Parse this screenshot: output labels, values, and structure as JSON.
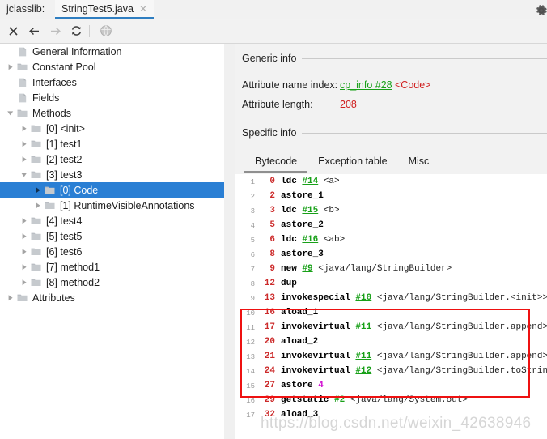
{
  "window": {
    "app_label": "jclasslib:",
    "gear_icon": "gear-icon"
  },
  "tab": {
    "title": "StringTest5.java",
    "close_glyph": "✕"
  },
  "toolbar": {
    "buttons": [
      {
        "name": "close-button",
        "glyph": "✕",
        "enabled": true
      },
      {
        "name": "back-button",
        "glyph": "←",
        "enabled": true
      },
      {
        "name": "forward-button",
        "glyph": "→",
        "enabled": false
      },
      {
        "name": "reload-button",
        "glyph": "⟳",
        "enabled": true
      },
      {
        "name": "browse-button",
        "glyph": "🌐",
        "enabled": false
      }
    ]
  },
  "tree": {
    "items": [
      {
        "label": "General Information",
        "indent": 1,
        "twist": "none",
        "icon": "file",
        "selected": false
      },
      {
        "label": "Constant Pool",
        "indent": 1,
        "twist": "collapsed",
        "icon": "folder",
        "selected": false
      },
      {
        "label": "Interfaces",
        "indent": 1,
        "twist": "none",
        "icon": "file",
        "selected": false
      },
      {
        "label": "Fields",
        "indent": 1,
        "twist": "none",
        "icon": "file",
        "selected": false
      },
      {
        "label": "Methods",
        "indent": 1,
        "twist": "expanded",
        "icon": "folder",
        "selected": false
      },
      {
        "label": "[0] <init>",
        "indent": 2,
        "twist": "collapsed",
        "icon": "folder",
        "selected": false
      },
      {
        "label": "[1] test1",
        "indent": 2,
        "twist": "collapsed",
        "icon": "folder",
        "selected": false
      },
      {
        "label": "[2] test2",
        "indent": 2,
        "twist": "collapsed",
        "icon": "folder",
        "selected": false
      },
      {
        "label": "[3] test3",
        "indent": 2,
        "twist": "expanded",
        "icon": "folder",
        "selected": false
      },
      {
        "label": "[0] Code",
        "indent": 3,
        "twist": "collapsed",
        "icon": "folder",
        "selected": true
      },
      {
        "label": "[1] RuntimeVisibleAnnotations",
        "indent": 3,
        "twist": "collapsed",
        "icon": "folder",
        "selected": false
      },
      {
        "label": "[4] test4",
        "indent": 2,
        "twist": "collapsed",
        "icon": "folder",
        "selected": false
      },
      {
        "label": "[5] test5",
        "indent": 2,
        "twist": "collapsed",
        "icon": "folder",
        "selected": false
      },
      {
        "label": "[6] test6",
        "indent": 2,
        "twist": "collapsed",
        "icon": "folder",
        "selected": false
      },
      {
        "label": "[7] method1",
        "indent": 2,
        "twist": "collapsed",
        "icon": "folder",
        "selected": false
      },
      {
        "label": "[8] method2",
        "indent": 2,
        "twist": "collapsed",
        "icon": "folder",
        "selected": false
      },
      {
        "label": "Attributes",
        "indent": 1,
        "twist": "collapsed",
        "icon": "folder",
        "selected": false
      }
    ]
  },
  "detail": {
    "generic_info_title": "Generic info",
    "specific_info_title": "Specific info",
    "attribute_name_index_label": "Attribute name index:",
    "attribute_name_index_link": "cp_info #28",
    "attribute_name_index_value": "<Code>",
    "attribute_length_label": "Attribute length:",
    "attribute_length_value": "208",
    "tabs": [
      {
        "label": "Bytecode",
        "active": true
      },
      {
        "label": "Exception table",
        "active": false
      },
      {
        "label": "Misc",
        "active": false
      }
    ]
  },
  "bytecode": {
    "lines": [
      {
        "no": "1",
        "offset": "0",
        "mnemonic": "ldc",
        "ref": "#14",
        "desc": "<a>",
        "highlighted": false
      },
      {
        "no": "2",
        "offset": "2",
        "mnemonic": "astore_1",
        "ref": "",
        "desc": "",
        "highlighted": false
      },
      {
        "no": "3",
        "offset": "3",
        "mnemonic": "ldc",
        "ref": "#15",
        "desc": "<b>",
        "highlighted": false
      },
      {
        "no": "4",
        "offset": "5",
        "mnemonic": "astore_2",
        "ref": "",
        "desc": "",
        "highlighted": false
      },
      {
        "no": "5",
        "offset": "6",
        "mnemonic": "ldc",
        "ref": "#16",
        "desc": "<ab>",
        "highlighted": false
      },
      {
        "no": "6",
        "offset": "8",
        "mnemonic": "astore_3",
        "ref": "",
        "desc": "",
        "highlighted": false
      },
      {
        "no": "7",
        "offset": "9",
        "mnemonic": "new",
        "ref": "#9",
        "desc": "<java/lang/StringBuilder>",
        "highlighted": false
      },
      {
        "no": "8",
        "offset": "12",
        "mnemonic": "dup",
        "ref": "",
        "desc": "",
        "highlighted": false
      },
      {
        "no": "9",
        "offset": "13",
        "mnemonic": "invokespecial",
        "ref": "#10",
        "desc": "<java/lang/StringBuilder.<init>>",
        "highlighted": true
      },
      {
        "no": "10",
        "offset": "16",
        "mnemonic": "aload_1",
        "ref": "",
        "desc": "",
        "highlighted": true
      },
      {
        "no": "11",
        "offset": "17",
        "mnemonic": "invokevirtual",
        "ref": "#11",
        "desc": "<java/lang/StringBuilder.append>",
        "highlighted": true
      },
      {
        "no": "12",
        "offset": "20",
        "mnemonic": "aload_2",
        "ref": "",
        "desc": "",
        "highlighted": true
      },
      {
        "no": "13",
        "offset": "21",
        "mnemonic": "invokevirtual",
        "ref": "#11",
        "desc": "<java/lang/StringBuilder.append>",
        "highlighted": true
      },
      {
        "no": "14",
        "offset": "24",
        "mnemonic": "invokevirtual",
        "ref": "#12",
        "desc": "<java/lang/StringBuilder.toString>",
        "highlighted": true
      },
      {
        "no": "15",
        "offset": "27",
        "mnemonic": "astore",
        "ref": "",
        "arg": "4",
        "desc": "",
        "highlighted": false
      },
      {
        "no": "16",
        "offset": "29",
        "mnemonic": "getstatic",
        "ref": "#2",
        "desc": "<java/lang/System.out>",
        "highlighted": false
      },
      {
        "no": "17",
        "offset": "32",
        "mnemonic": "aload_3",
        "ref": "",
        "desc": "",
        "highlighted": false
      }
    ]
  },
  "watermark": "https://blog.csdn.net/weixin_42638946",
  "colors": {
    "selection_blue": "#2a7fd4",
    "tab_accent": "#2f7ec1",
    "cp_ref_green": "#18a018",
    "offset_red": "#cc2b2b",
    "highlight_red": "#ee1111"
  }
}
